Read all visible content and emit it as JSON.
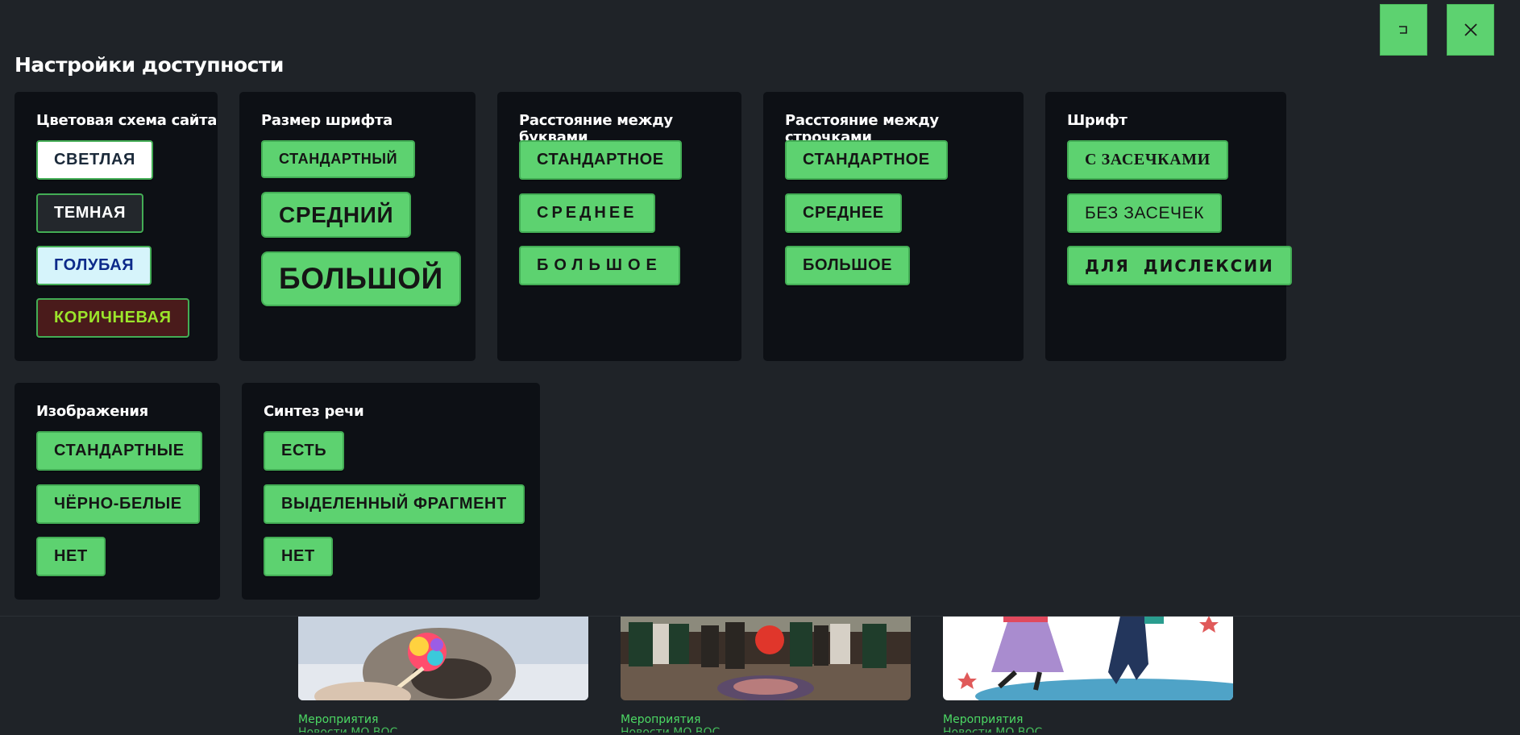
{
  "panel": {
    "title": "Настройки доступности",
    "sections": {
      "color_scheme": {
        "title": "Цветовая схема сайта",
        "options": [
          "СВЕТЛАЯ",
          "ТЕМНАЯ",
          "ГОЛУБАЯ",
          "КОРИЧНЕВАЯ"
        ]
      },
      "font_size": {
        "title": "Размер шрифта",
        "options": [
          "СТАНДАРТНЫЙ",
          "СРЕДНИЙ",
          "БОЛЬШОЙ"
        ]
      },
      "letter_spacing": {
        "title": "Расстояние между буквами",
        "options": [
          "СТАНДАРТНОЕ",
          "СРЕДНЕЕ",
          "БОЛЬШОЕ"
        ]
      },
      "line_spacing": {
        "title": "Расстояние между строчками",
        "options": [
          "СТАНДАРТНОЕ",
          "СРЕДНЕЕ",
          "БОЛЬШОЕ"
        ]
      },
      "font": {
        "title": "Шрифт",
        "options": [
          "С ЗАСЕЧКАМИ",
          "БЕЗ ЗАСЕЧЕК",
          "ДЛЯ ДИСЛЕКСИИ"
        ]
      },
      "images": {
        "title": "Изображения",
        "options": [
          "СТАНДАРТНЫЕ",
          "ЧЁРНО-БЕЛЫЕ",
          "НЕТ"
        ]
      },
      "speech": {
        "title": "Синтез речи",
        "options": [
          "ЕСТЬ",
          "ВЫДЕЛЕННЫЙ ФРАГМЕНТ",
          "НЕТ"
        ]
      }
    }
  },
  "top_buttons": {
    "collapse_icon": "collapse-icon",
    "close_icon": "close-icon"
  },
  "colors": {
    "accent": "#5dd270",
    "panel_bg": "#1f2328",
    "section_bg": "#0d1015"
  },
  "cards": [
    {
      "category": "Мероприятия",
      "subtitle": "Новости МО ВОС"
    },
    {
      "category": "Мероприятия",
      "subtitle": "Новости МО ВОС"
    },
    {
      "category": "Мероприятия",
      "subtitle": "Новости МО ВОС"
    }
  ]
}
